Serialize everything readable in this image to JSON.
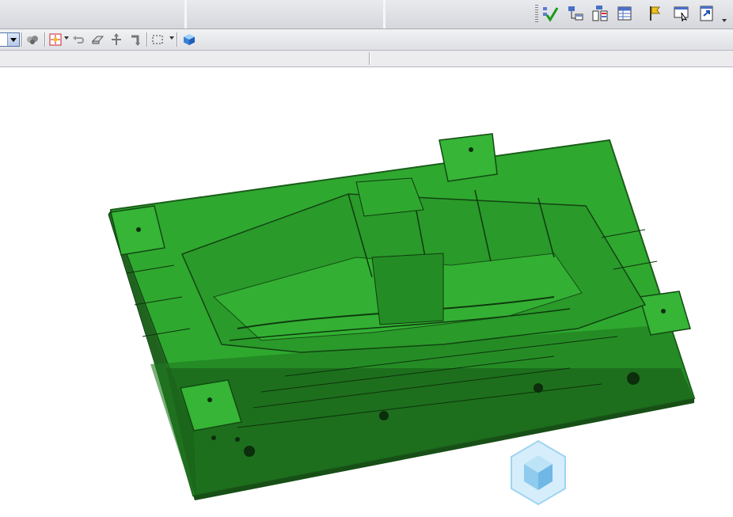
{
  "toolbar_top": {
    "buttons": [
      {
        "name": "check-workflow-icon"
      },
      {
        "name": "tree-expand-icon"
      },
      {
        "name": "tree-structure-icon"
      },
      {
        "name": "table-view-icon"
      },
      {
        "name": "flag-marker-icon"
      },
      {
        "name": "select-view-icon"
      },
      {
        "name": "export-document-icon"
      }
    ]
  },
  "toolbar_second": {
    "buttons": [
      {
        "name": "view-options-icon"
      },
      {
        "name": "snap-point-icon"
      },
      {
        "name": "undo-arrow-icon"
      },
      {
        "name": "eraser-icon"
      },
      {
        "name": "move-axis-icon"
      },
      {
        "name": "rotate-icon"
      },
      {
        "name": "selection-box-icon"
      },
      {
        "name": "cube-shading-icon"
      }
    ]
  },
  "viewport": {
    "model_color": "#2fa82f",
    "model_shadow": "#1d6e1d",
    "triad_color": "#9fd4f2"
  }
}
